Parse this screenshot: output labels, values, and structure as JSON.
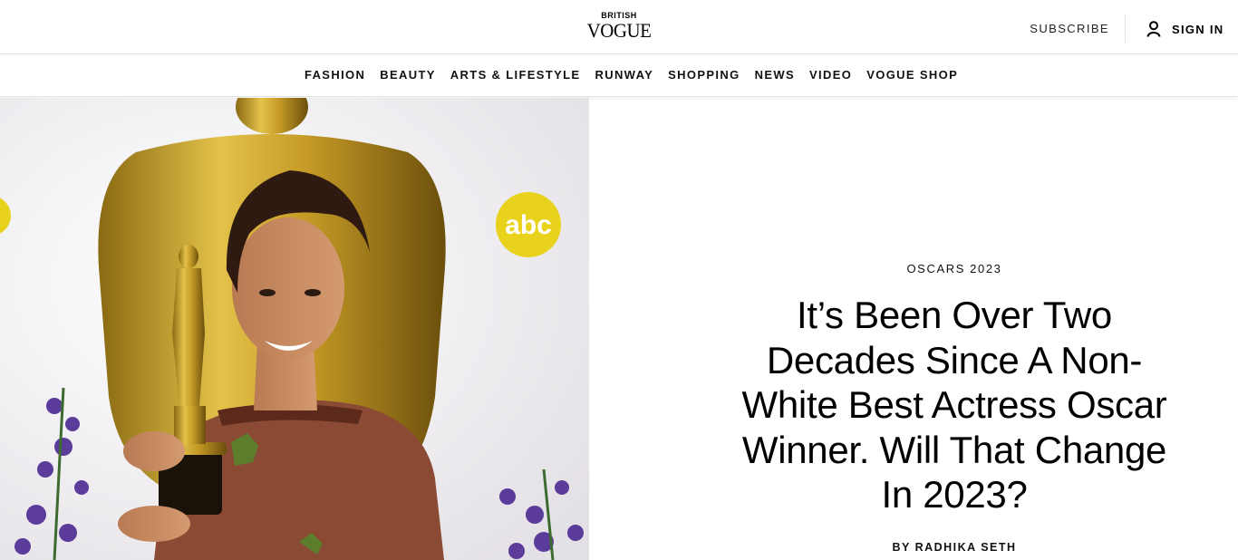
{
  "header": {
    "logo_top": "BRITISH",
    "logo_main": "VOGUE",
    "subscribe_label": "SUBSCRIBE",
    "signin_label": "SIGN IN"
  },
  "nav": {
    "items": [
      "FASHION",
      "BEAUTY",
      "ARTS & LIFESTYLE",
      "RUNWAY",
      "SHOPPING",
      "NEWS",
      "VIDEO",
      "VOGUE SHOP"
    ]
  },
  "hero_image": {
    "sign_text": "abc"
  },
  "article": {
    "rubric": "OSCARS 2023",
    "headline": "It’s Been Over Two Decades Since A Non-White Best Actress Oscar Winner. Will That Change In 2023?",
    "byline": "BY RADHIKA SETH"
  },
  "colors": {
    "background": "#ffffff",
    "text": "#000000",
    "divider": "#e2e2e2",
    "oscar_gold": "#c9a227",
    "abc_yellow": "#e8d21b"
  }
}
